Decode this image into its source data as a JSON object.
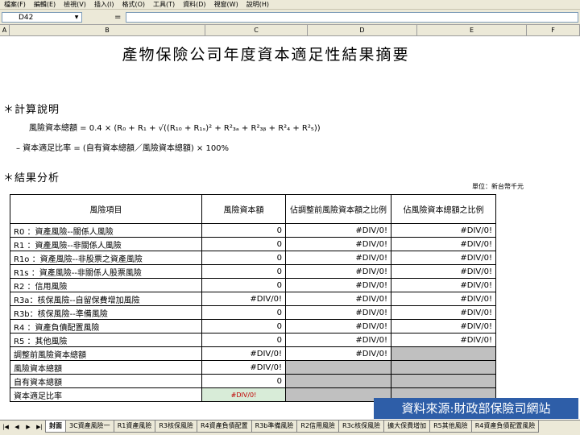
{
  "menu": [
    "檔案(F)",
    "編輯(E)",
    "檢視(V)",
    "插入(I)",
    "格式(O)",
    "工具(T)",
    "資料(D)",
    "視窗(W)",
    "說明(H)"
  ],
  "formula_bar": {
    "cell_ref": "D42",
    "equals": "=",
    "content": ""
  },
  "columns": [
    "A",
    "B",
    "C",
    "D",
    "E",
    "F"
  ],
  "sheet": {
    "title": "產物保險公司年度資本適足性結果摘要",
    "calc_heading": "＊計算說明",
    "formula_1": "風險資本總額 = 0.4 × (R₀ + R₁ + √((R₁₀ + R₁ₛ)² + R²₃ₐ + R²₃ᵦ + R²₄ + R²₅))",
    "formula_2": "– 資本適足比率 = (自有資本總額／風險資本總額) × 100%",
    "results_heading": "＊結果分析",
    "unit": "單位：新台幣千元",
    "table": {
      "headers": [
        "風險項目",
        "風險資本額",
        "佔調整前風險資本額之比例",
        "佔風險資本總額之比例"
      ],
      "rows": [
        {
          "item": "R0 ：資產風險--關係人風險",
          "capital": "0",
          "pct_pre": "#DIV/0!",
          "pct_total": "#DIV/0!"
        },
        {
          "item": "R1 ：資產風險--非關係人風險",
          "capital": "0",
          "pct_pre": "#DIV/0!",
          "pct_total": "#DIV/0!"
        },
        {
          "item": "R1o ：資產風險--非股票之資產風險",
          "capital": "0",
          "pct_pre": "#DIV/0!",
          "pct_total": "#DIV/0!"
        },
        {
          "item": "R1s ：資產風險--非關係人股票風險",
          "capital": "0",
          "pct_pre": "#DIV/0!",
          "pct_total": "#DIV/0!"
        },
        {
          "item": "R2 ：信用風險",
          "capital": "0",
          "pct_pre": "#DIV/0!",
          "pct_total": "#DIV/0!"
        },
        {
          "item": "R3a：核保風險--自留保費增加風險",
          "capital": "#DIV/0!",
          "pct_pre": "#DIV/0!",
          "pct_total": "#DIV/0!"
        },
        {
          "item": "R3b：核保風險--準備風險",
          "capital": "0",
          "pct_pre": "#DIV/0!",
          "pct_total": "#DIV/0!"
        },
        {
          "item": "R4 ：資產負債配置風險",
          "capital": "0",
          "pct_pre": "#DIV/0!",
          "pct_total": "#DIV/0!"
        },
        {
          "item": "R5 ：其他風險",
          "capital": "0",
          "pct_pre": "#DIV/0!",
          "pct_total": "#DIV/0!"
        },
        {
          "item": "調整前風險資本總額",
          "capital": "#DIV/0!",
          "pct_pre": "#DIV/0!",
          "pct_total": ""
        },
        {
          "item": "風險資本總額",
          "capital": "#DIV/0!",
          "pct_pre": "",
          "pct_total": ""
        },
        {
          "item": "自有資本總額",
          "capital": "0",
          "pct_pre": "",
          "pct_total": ""
        },
        {
          "item": "資本適足比率",
          "capital": "#DIV/0!",
          "pct_pre": "",
          "pct_total": ""
        }
      ]
    }
  },
  "banner": "資料來源:財政部保險司網站",
  "tabs": [
    "封面",
    "3C資產風險一",
    "R1資產風險",
    "R3核保風險",
    "R4資產負債配置",
    "R3b準備風險",
    "R2信用風險",
    "R3c核保風險",
    "擴大保費增加",
    "R5其他風險",
    "R4資產負債配置風險"
  ],
  "colors": {
    "shade": "#c0c0c0",
    "banner_bg": "#2e5ea8",
    "ratio_cell_bg": "#d8ecd8",
    "error_text": "#c00000"
  }
}
